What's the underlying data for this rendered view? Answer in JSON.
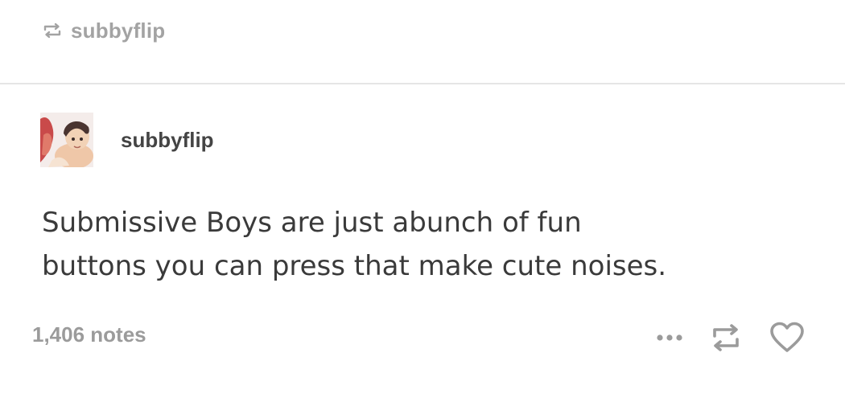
{
  "reblog": {
    "username": "subbyflip",
    "icon": "reblog-icon"
  },
  "post": {
    "author": {
      "username": "subbyflip",
      "avatar": "anime-avatar"
    },
    "body_lines": [
      "Submissive Boys are just abunch of fun",
      "buttons you can press that make cute noises."
    ]
  },
  "footer": {
    "notes": "1,406 notes",
    "actions": [
      "more-icon",
      "reblog-icon",
      "heart-icon"
    ]
  },
  "colors": {
    "muted_text": "#a3a3a3",
    "body_text": "#3a3a3a",
    "divider": "#e5e5e5",
    "icon": "#9b9b9b"
  }
}
